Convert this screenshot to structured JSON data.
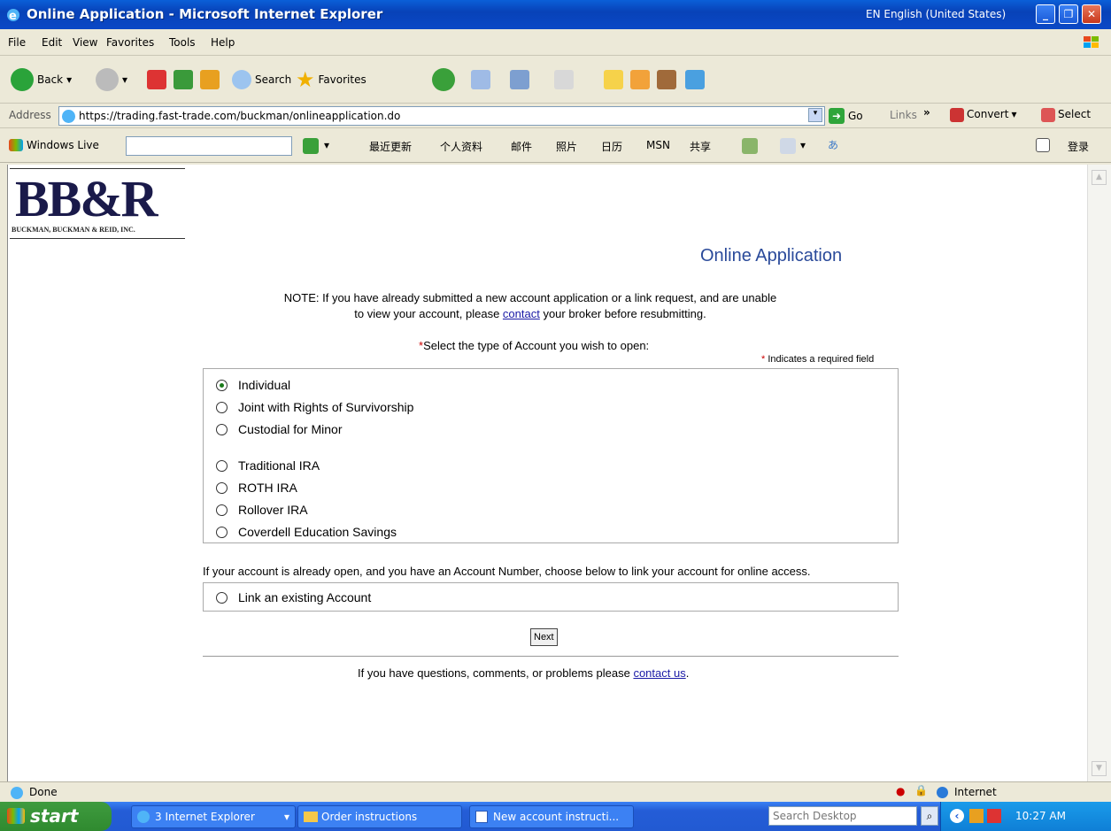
{
  "window": {
    "title": "Online Application - Microsoft Internet Explorer",
    "language_indicator": "EN English (United States)"
  },
  "menu": [
    "File",
    "Edit",
    "View",
    "Favorites",
    "Tools",
    "Help"
  ],
  "toolbar": {
    "back": "Back",
    "search": "Search",
    "favorites": "Favorites"
  },
  "addressbar": {
    "label": "Address",
    "url": "https://trading.fast-trade.com/buckman/onlineapplication.do",
    "go": "Go",
    "links": "Links",
    "convert": "Convert",
    "select": "Select"
  },
  "windows_live": {
    "label": "Windows Live",
    "items": [
      "最近更新",
      "个人资料",
      "邮件",
      "照片",
      "日历",
      "MSN",
      "共享"
    ],
    "login": "登录"
  },
  "page": {
    "logo_text": "BB&R",
    "logo_subtitle": "BUCKMAN, BUCKMAN & REID, INC.",
    "title": "Online Application",
    "note_line1": "NOTE: If you have already submitted a new account application or a link request, and are unable",
    "note_line2_pre": "to view your account, please ",
    "note_link": "contact",
    "note_line2_post": " your broker before resubmitting.",
    "select_prompt": "Select the type of Account you wish to open:",
    "required_note": "Indicates a required field",
    "account_types_group1": [
      "Individual",
      "Joint with Rights of Survivorship",
      "Custodial for Minor"
    ],
    "account_types_group2": [
      "Traditional IRA",
      "ROTH IRA",
      "Rollover IRA",
      "Coverdell Education Savings"
    ],
    "selected": "Individual",
    "link_prompt": "If your account is already open, and you have an Account Number, choose below to link your account for online access.",
    "link_option": "Link an existing Account",
    "next_button": "Next",
    "footer_pre": "If you have questions, comments, or problems please ",
    "footer_link": "contact us",
    "footer_post": "."
  },
  "status": {
    "text": "Done",
    "zone": "Internet"
  },
  "taskbar": {
    "start": "start",
    "tasks": [
      "3 Internet Explorer",
      "Order instructions",
      "New account instructi..."
    ],
    "search_placeholder": "Search Desktop",
    "clock": "10:27 AM"
  },
  "colors": {
    "title_blue": "#0a4bc4",
    "heading_blue": "#2a4a9a",
    "link": "#1a1aa6",
    "required_red": "#cc0000"
  }
}
